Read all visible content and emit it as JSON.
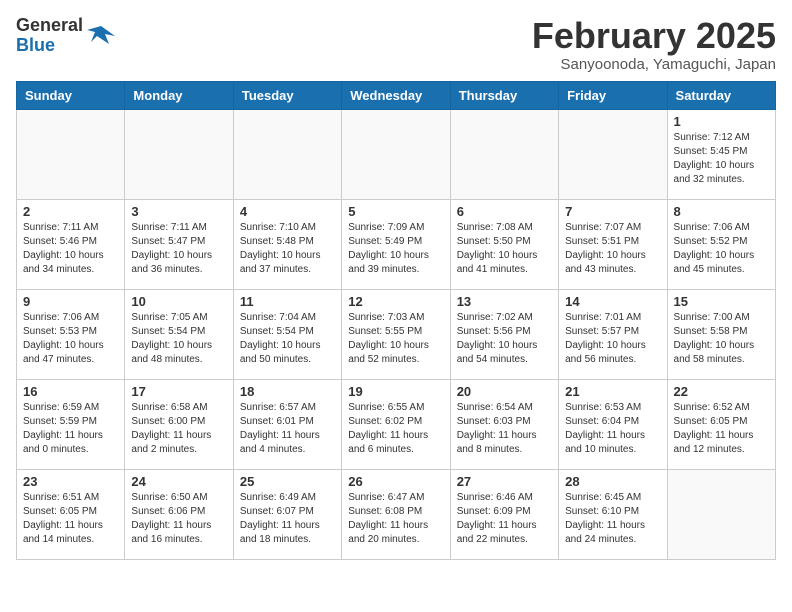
{
  "logo": {
    "general": "General",
    "blue": "Blue"
  },
  "title": "February 2025",
  "location": "Sanyoonoda, Yamaguchi, Japan",
  "days_of_week": [
    "Sunday",
    "Monday",
    "Tuesday",
    "Wednesday",
    "Thursday",
    "Friday",
    "Saturday"
  ],
  "weeks": [
    [
      {
        "day": "",
        "info": ""
      },
      {
        "day": "",
        "info": ""
      },
      {
        "day": "",
        "info": ""
      },
      {
        "day": "",
        "info": ""
      },
      {
        "day": "",
        "info": ""
      },
      {
        "day": "",
        "info": ""
      },
      {
        "day": "1",
        "info": "Sunrise: 7:12 AM\nSunset: 5:45 PM\nDaylight: 10 hours\nand 32 minutes."
      }
    ],
    [
      {
        "day": "2",
        "info": "Sunrise: 7:11 AM\nSunset: 5:46 PM\nDaylight: 10 hours\nand 34 minutes."
      },
      {
        "day": "3",
        "info": "Sunrise: 7:11 AM\nSunset: 5:47 PM\nDaylight: 10 hours\nand 36 minutes."
      },
      {
        "day": "4",
        "info": "Sunrise: 7:10 AM\nSunset: 5:48 PM\nDaylight: 10 hours\nand 37 minutes."
      },
      {
        "day": "5",
        "info": "Sunrise: 7:09 AM\nSunset: 5:49 PM\nDaylight: 10 hours\nand 39 minutes."
      },
      {
        "day": "6",
        "info": "Sunrise: 7:08 AM\nSunset: 5:50 PM\nDaylight: 10 hours\nand 41 minutes."
      },
      {
        "day": "7",
        "info": "Sunrise: 7:07 AM\nSunset: 5:51 PM\nDaylight: 10 hours\nand 43 minutes."
      },
      {
        "day": "8",
        "info": "Sunrise: 7:06 AM\nSunset: 5:52 PM\nDaylight: 10 hours\nand 45 minutes."
      }
    ],
    [
      {
        "day": "9",
        "info": "Sunrise: 7:06 AM\nSunset: 5:53 PM\nDaylight: 10 hours\nand 47 minutes."
      },
      {
        "day": "10",
        "info": "Sunrise: 7:05 AM\nSunset: 5:54 PM\nDaylight: 10 hours\nand 48 minutes."
      },
      {
        "day": "11",
        "info": "Sunrise: 7:04 AM\nSunset: 5:54 PM\nDaylight: 10 hours\nand 50 minutes."
      },
      {
        "day": "12",
        "info": "Sunrise: 7:03 AM\nSunset: 5:55 PM\nDaylight: 10 hours\nand 52 minutes."
      },
      {
        "day": "13",
        "info": "Sunrise: 7:02 AM\nSunset: 5:56 PM\nDaylight: 10 hours\nand 54 minutes."
      },
      {
        "day": "14",
        "info": "Sunrise: 7:01 AM\nSunset: 5:57 PM\nDaylight: 10 hours\nand 56 minutes."
      },
      {
        "day": "15",
        "info": "Sunrise: 7:00 AM\nSunset: 5:58 PM\nDaylight: 10 hours\nand 58 minutes."
      }
    ],
    [
      {
        "day": "16",
        "info": "Sunrise: 6:59 AM\nSunset: 5:59 PM\nDaylight: 11 hours\nand 0 minutes."
      },
      {
        "day": "17",
        "info": "Sunrise: 6:58 AM\nSunset: 6:00 PM\nDaylight: 11 hours\nand 2 minutes."
      },
      {
        "day": "18",
        "info": "Sunrise: 6:57 AM\nSunset: 6:01 PM\nDaylight: 11 hours\nand 4 minutes."
      },
      {
        "day": "19",
        "info": "Sunrise: 6:55 AM\nSunset: 6:02 PM\nDaylight: 11 hours\nand 6 minutes."
      },
      {
        "day": "20",
        "info": "Sunrise: 6:54 AM\nSunset: 6:03 PM\nDaylight: 11 hours\nand 8 minutes."
      },
      {
        "day": "21",
        "info": "Sunrise: 6:53 AM\nSunset: 6:04 PM\nDaylight: 11 hours\nand 10 minutes."
      },
      {
        "day": "22",
        "info": "Sunrise: 6:52 AM\nSunset: 6:05 PM\nDaylight: 11 hours\nand 12 minutes."
      }
    ],
    [
      {
        "day": "23",
        "info": "Sunrise: 6:51 AM\nSunset: 6:05 PM\nDaylight: 11 hours\nand 14 minutes."
      },
      {
        "day": "24",
        "info": "Sunrise: 6:50 AM\nSunset: 6:06 PM\nDaylight: 11 hours\nand 16 minutes."
      },
      {
        "day": "25",
        "info": "Sunrise: 6:49 AM\nSunset: 6:07 PM\nDaylight: 11 hours\nand 18 minutes."
      },
      {
        "day": "26",
        "info": "Sunrise: 6:47 AM\nSunset: 6:08 PM\nDaylight: 11 hours\nand 20 minutes."
      },
      {
        "day": "27",
        "info": "Sunrise: 6:46 AM\nSunset: 6:09 PM\nDaylight: 11 hours\nand 22 minutes."
      },
      {
        "day": "28",
        "info": "Sunrise: 6:45 AM\nSunset: 6:10 PM\nDaylight: 11 hours\nand 24 minutes."
      },
      {
        "day": "",
        "info": ""
      }
    ]
  ]
}
